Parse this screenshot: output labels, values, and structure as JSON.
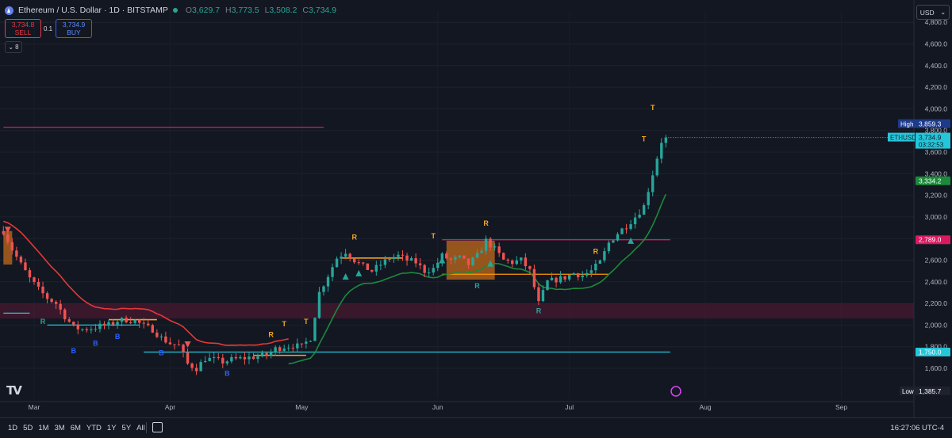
{
  "header": {
    "title": "Ethereum / U.S. Dollar · 1D · BITSTAMP",
    "open_label": "O",
    "open": "3,629.7",
    "high_label": "H",
    "high": "3,773.5",
    "low_label": "L",
    "low": "3,508.2",
    "close_label": "C",
    "close": "3,734.9"
  },
  "trade": {
    "sell_price": "3,734.8",
    "sell_label": "SELL",
    "spread": "0.1",
    "buy_price": "3,734.9",
    "buy_label": "BUY"
  },
  "indicators_toggle": "8",
  "currency": "USD",
  "timeframes": [
    "1D",
    "5D",
    "1M",
    "3M",
    "6M",
    "YTD",
    "1Y",
    "5Y",
    "All"
  ],
  "clock": "16:27:06 UTC-4",
  "logo_text": "TV",
  "colors": {
    "bg": "#131722",
    "up": "#26a69a",
    "down": "#ef5350",
    "up_bright": "#22ab94",
    "trend_red": "#e53935",
    "trend_green": "#1b8a3a",
    "magenta": "#d81b60",
    "cyan": "#26c6da",
    "orange": "#ff9800",
    "signal_R": "#26a69a",
    "signal_T": "#f5a623",
    "signal_B": "#2962ff"
  },
  "chart_data": {
    "type": "candlestick",
    "symbol": "ETHUSD",
    "ylim": [
      1300,
      4900
    ],
    "yticks": [
      1600,
      1800,
      2000,
      2200,
      2400,
      2600,
      2800,
      3000,
      3200,
      3400,
      3600,
      3800,
      4000,
      4200,
      4400,
      4600,
      4800
    ],
    "ytick_labels": [
      "1,600.0",
      "1,800.0",
      "2,000.0",
      "2,200.0",
      "2,400.0",
      "2,600.0",
      "2,800.0",
      "3,000.0",
      "3,200.0",
      "3,400.0",
      "3,600.0",
      "3,800.0",
      "4,000.0",
      "4,200.0",
      "4,400.0",
      "4,600.0",
      "4,800.0"
    ],
    "xlabels": [
      {
        "label": "Mar",
        "day": 0
      },
      {
        "label": "Apr",
        "day": 31
      },
      {
        "label": "May",
        "day": 61
      },
      {
        "label": "Jun",
        "day": 92
      },
      {
        "label": "Jul",
        "day": 122
      },
      {
        "label": "Aug",
        "day": 153
      },
      {
        "label": "Sep",
        "day": 184
      }
    ],
    "candles_day_range": [
      -7,
      144
    ],
    "close_path": [
      [
        -7,
        2870
      ],
      [
        -5,
        2700
      ],
      [
        -3,
        2560
      ],
      [
        -1,
        2430
      ],
      [
        1,
        2330
      ],
      [
        3,
        2250
      ],
      [
        5,
        2200
      ],
      [
        7,
        2080
      ],
      [
        9,
        1980
      ],
      [
        11,
        1960
      ],
      [
        13,
        1970
      ],
      [
        15,
        1990
      ],
      [
        17,
        2000
      ],
      [
        19,
        2040
      ],
      [
        21,
        2050
      ],
      [
        23,
        2040
      ],
      [
        25,
        1990
      ],
      [
        27,
        1960
      ],
      [
        29,
        1880
      ],
      [
        31,
        1830
      ],
      [
        33,
        1810
      ],
      [
        35,
        1640
      ],
      [
        37,
        1600
      ],
      [
        39,
        1690
      ],
      [
        41,
        1680
      ],
      [
        43,
        1660
      ],
      [
        45,
        1680
      ],
      [
        47,
        1690
      ],
      [
        49,
        1700
      ],
      [
        51,
        1710
      ],
      [
        53,
        1720
      ],
      [
        55,
        1780
      ],
      [
        57,
        1800
      ],
      [
        59,
        1810
      ],
      [
        61,
        1800
      ],
      [
        63,
        1880
      ],
      [
        65,
        2300
      ],
      [
        67,
        2460
      ],
      [
        69,
        2620
      ],
      [
        71,
        2680
      ],
      [
        73,
        2600
      ],
      [
        75,
        2540
      ],
      [
        77,
        2500
      ],
      [
        79,
        2560
      ],
      [
        81,
        2620
      ],
      [
        83,
        2640
      ],
      [
        85,
        2600
      ],
      [
        87,
        2580
      ],
      [
        89,
        2500
      ],
      [
        91,
        2520
      ],
      [
        93,
        2640
      ],
      [
        95,
        2600
      ],
      [
        97,
        2620
      ],
      [
        99,
        2560
      ],
      [
        101,
        2640
      ],
      [
        103,
        2780
      ],
      [
        105,
        2700
      ],
      [
        107,
        2600
      ],
      [
        109,
        2580
      ],
      [
        111,
        2600
      ],
      [
        113,
        2500
      ],
      [
        115,
        2200
      ],
      [
        117,
        2400
      ],
      [
        119,
        2420
      ],
      [
        121,
        2440
      ],
      [
        123,
        2480
      ],
      [
        125,
        2460
      ],
      [
        127,
        2500
      ],
      [
        129,
        2580
      ],
      [
        131,
        2760
      ],
      [
        133,
        2850
      ],
      [
        135,
        2920
      ],
      [
        137,
        3000
      ],
      [
        139,
        3100
      ],
      [
        141,
        3400
      ],
      [
        143,
        3700
      ],
      [
        144,
        3734.9
      ]
    ],
    "current_price": 3734.9,
    "session_high": 3859.3,
    "session_low": 1385.7,
    "levels": [
      {
        "value": 3334.2,
        "label": "3,334.2",
        "color": "#1b8a3a"
      },
      {
        "value": 2789.0,
        "label": "2,789.0",
        "color": "#d81b60"
      },
      {
        "value": 1750.0,
        "label": "1,750.0",
        "color": "#26c6da"
      }
    ],
    "horizontal_lines": [
      {
        "price": 3830,
        "from_day": -7,
        "to_day": 66,
        "color": "#d81b60"
      },
      {
        "price": 2789,
        "from_day": 93,
        "to_day": 145,
        "color": "#d81b60"
      },
      {
        "price": 1750,
        "from_day": 25,
        "to_day": 145,
        "color": "#26c6da"
      },
      {
        "price": 2110,
        "from_day": -7,
        "to_day": -1,
        "color": "#26c6da"
      },
      {
        "price": 2000,
        "from_day": 3,
        "to_day": 24,
        "color": "#26c6da"
      },
      {
        "price": 2470,
        "from_day": 93,
        "to_day": 131,
        "color": "#ff9800"
      }
    ],
    "zones": [
      {
        "from": 2060,
        "to": 2200,
        "color": "#5a1a34"
      }
    ],
    "markers": [
      {
        "text": "R",
        "day": 2,
        "price": 2010,
        "color": "#26a69a"
      },
      {
        "text": "B",
        "day": 9,
        "price": 1740,
        "color": "#2962ff"
      },
      {
        "text": "B",
        "day": 14,
        "price": 1810,
        "color": "#2962ff"
      },
      {
        "text": "B",
        "day": 19,
        "price": 1870,
        "color": "#2962ff"
      },
      {
        "text": "B",
        "day": 29,
        "price": 1720,
        "color": "#2962ff"
      },
      {
        "text": "B",
        "day": 44,
        "price": 1530,
        "color": "#2962ff"
      },
      {
        "text": "R",
        "day": 54,
        "price": 1890,
        "color": "#f5a623"
      },
      {
        "text": "T",
        "day": 57,
        "price": 1990,
        "color": "#f5a623"
      },
      {
        "text": "T",
        "day": 62,
        "price": 2010,
        "color": "#f5a623"
      },
      {
        "text": "R",
        "day": 73,
        "price": 2790,
        "color": "#f5a623"
      },
      {
        "text": "T",
        "day": 91,
        "price": 2800,
        "color": "#f5a623"
      },
      {
        "text": "R",
        "day": 103,
        "price": 2920,
        "color": "#f5a623"
      },
      {
        "text": "R",
        "day": 101,
        "price": 2340,
        "color": "#26a69a"
      },
      {
        "text": "R",
        "day": 115,
        "price": 2110,
        "color": "#26a69a"
      },
      {
        "text": "R",
        "day": 128,
        "price": 2660,
        "color": "#f5a623"
      },
      {
        "text": "T",
        "day": 139,
        "price": 3700,
        "color": "#f5a623"
      },
      {
        "text": "T",
        "day": 141,
        "price": 3990,
        "color": "#f5a623"
      }
    ]
  },
  "axis_badges": {
    "high_label": "High",
    "high_value": "3,859.3",
    "ticker": "ETHUSD",
    "price": "3,734.9",
    "countdown": "03:32:53",
    "low_label": "Low",
    "low_value": "1,385.7"
  }
}
